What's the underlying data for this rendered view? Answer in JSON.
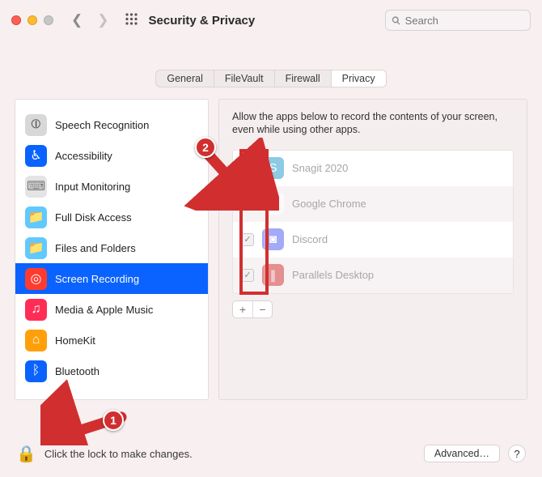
{
  "window": {
    "title": "Security & Privacy",
    "search_placeholder": "Search"
  },
  "tabs": [
    {
      "label": "General"
    },
    {
      "label": "FileVault"
    },
    {
      "label": "Firewall"
    },
    {
      "label": "Privacy",
      "active": true
    }
  ],
  "sidebar": {
    "items": [
      {
        "label": "Speech Recognition",
        "icon": "speech",
        "bg": "#d8d8d8",
        "fg": "#555"
      },
      {
        "label": "Accessibility",
        "icon": "accessibility",
        "bg": "#0a62ff",
        "fg": "#fff"
      },
      {
        "label": "Input Monitoring",
        "icon": "keyboard",
        "bg": "#e4e4e4",
        "fg": "#777"
      },
      {
        "label": "Full Disk Access",
        "icon": "folder",
        "bg": "#60c9ff",
        "fg": "#fff"
      },
      {
        "label": "Files and Folders",
        "icon": "folder",
        "bg": "#60c9ff",
        "fg": "#fff"
      },
      {
        "label": "Screen Recording",
        "icon": "record",
        "bg": "#ff3b30",
        "fg": "#fff",
        "selected": true
      },
      {
        "label": "Media & Apple Music",
        "icon": "music",
        "bg": "#ff2d55",
        "fg": "#fff"
      },
      {
        "label": "HomeKit",
        "icon": "home",
        "bg": "#ff9f0a",
        "fg": "#fff"
      },
      {
        "label": "Bluetooth",
        "icon": "bluetooth",
        "bg": "#0a62ff",
        "fg": "#fff"
      }
    ]
  },
  "detail": {
    "description": "Allow the apps below to record the contents of your screen, even while using other apps.",
    "apps": [
      {
        "name": "Snagit 2020",
        "checked": true,
        "icon_bg": "#2f9fd0",
        "glyph": "S"
      },
      {
        "name": "Google Chrome",
        "checked": false,
        "icon_bg": "#ffffff",
        "glyph": "◉"
      },
      {
        "name": "Discord",
        "checked": true,
        "icon_bg": "#5865f2",
        "glyph": "◙"
      },
      {
        "name": "Parallels Desktop",
        "checked": true,
        "icon_bg": "#d64040",
        "glyph": "∥"
      }
    ],
    "add_label": "+",
    "remove_label": "−"
  },
  "footer": {
    "lock_text": "Click the lock to make changes.",
    "advanced_label": "Advanced…",
    "help_label": "?"
  },
  "annotations": {
    "step1": "1",
    "step2": "2"
  }
}
